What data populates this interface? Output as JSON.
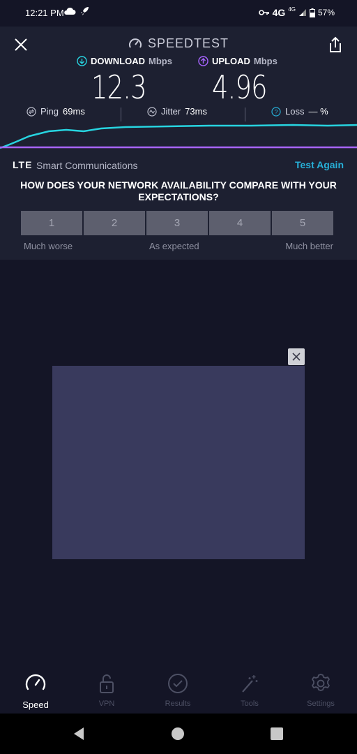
{
  "status": {
    "time": "12:21 PM",
    "network": "4G",
    "network_small": "4G",
    "battery": "57%"
  },
  "header": {
    "brand": "SPEEDTEST"
  },
  "download": {
    "label": "DOWNLOAD",
    "unit": "Mbps",
    "value": "12.3",
    "color": "#27d4e0"
  },
  "upload": {
    "label": "UPLOAD",
    "unit": "Mbps",
    "value": "4.96",
    "color": "#a764ff"
  },
  "stats": {
    "ping": {
      "label": "Ping",
      "value": "69ms"
    },
    "jitter": {
      "label": "Jitter",
      "value": "73ms"
    },
    "loss": {
      "label": "Loss",
      "value": "— %"
    }
  },
  "provider": {
    "tech": "LTE",
    "name": "Smart Communications",
    "test_again": "Test Again"
  },
  "survey": {
    "question": "HOW DOES YOUR NETWORK AVAILABILITY COMPARE WITH YOUR EXPECTATIONS?",
    "options": [
      "1",
      "2",
      "3",
      "4",
      "5"
    ],
    "low_label": "Much worse",
    "mid_label": "As expected",
    "high_label": "Much better"
  },
  "tabs": [
    {
      "label": "Speed",
      "icon": "speedometer-icon",
      "active": true
    },
    {
      "label": "VPN",
      "icon": "lock-icon",
      "active": false
    },
    {
      "label": "Results",
      "icon": "checkmark-circle-icon",
      "active": false
    },
    {
      "label": "Tools",
      "icon": "magic-wand-icon",
      "active": false
    },
    {
      "label": "Settings",
      "icon": "gear-icon",
      "active": false
    }
  ],
  "colors": {
    "accent": "#27b0d8",
    "background": "#141526",
    "panel": "#1d2031",
    "ad": "#393a5d"
  }
}
